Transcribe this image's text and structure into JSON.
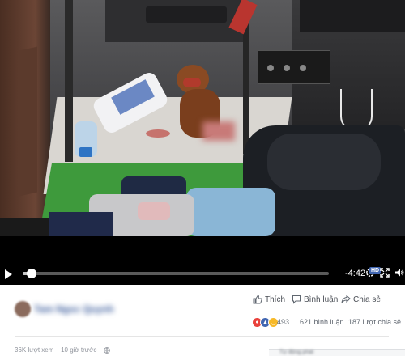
{
  "video": {
    "current_time": "-4:42",
    "progress": 0.03,
    "quality_badge": "HD"
  },
  "post": {
    "page_name": "Tam Ngoc Quynh",
    "actions": {
      "like": "Thích",
      "comment": "Bình luận",
      "share": "Chia sẻ"
    },
    "reaction_count": "493",
    "comments_count": "621 bình luận",
    "shares_count": "187 lượt chia sẻ",
    "views": "36K lượt xem",
    "time_ago": "10 giờ trước",
    "separator": "·",
    "next_up_label": "Tự động phát"
  },
  "colors": {
    "link": "#365899",
    "secondary_text": "#606770",
    "hd_badge": "#4267b2",
    "like_blue": "#4267b2",
    "angry_red": "#e9413c",
    "haha_yellow": "#f7b928"
  }
}
